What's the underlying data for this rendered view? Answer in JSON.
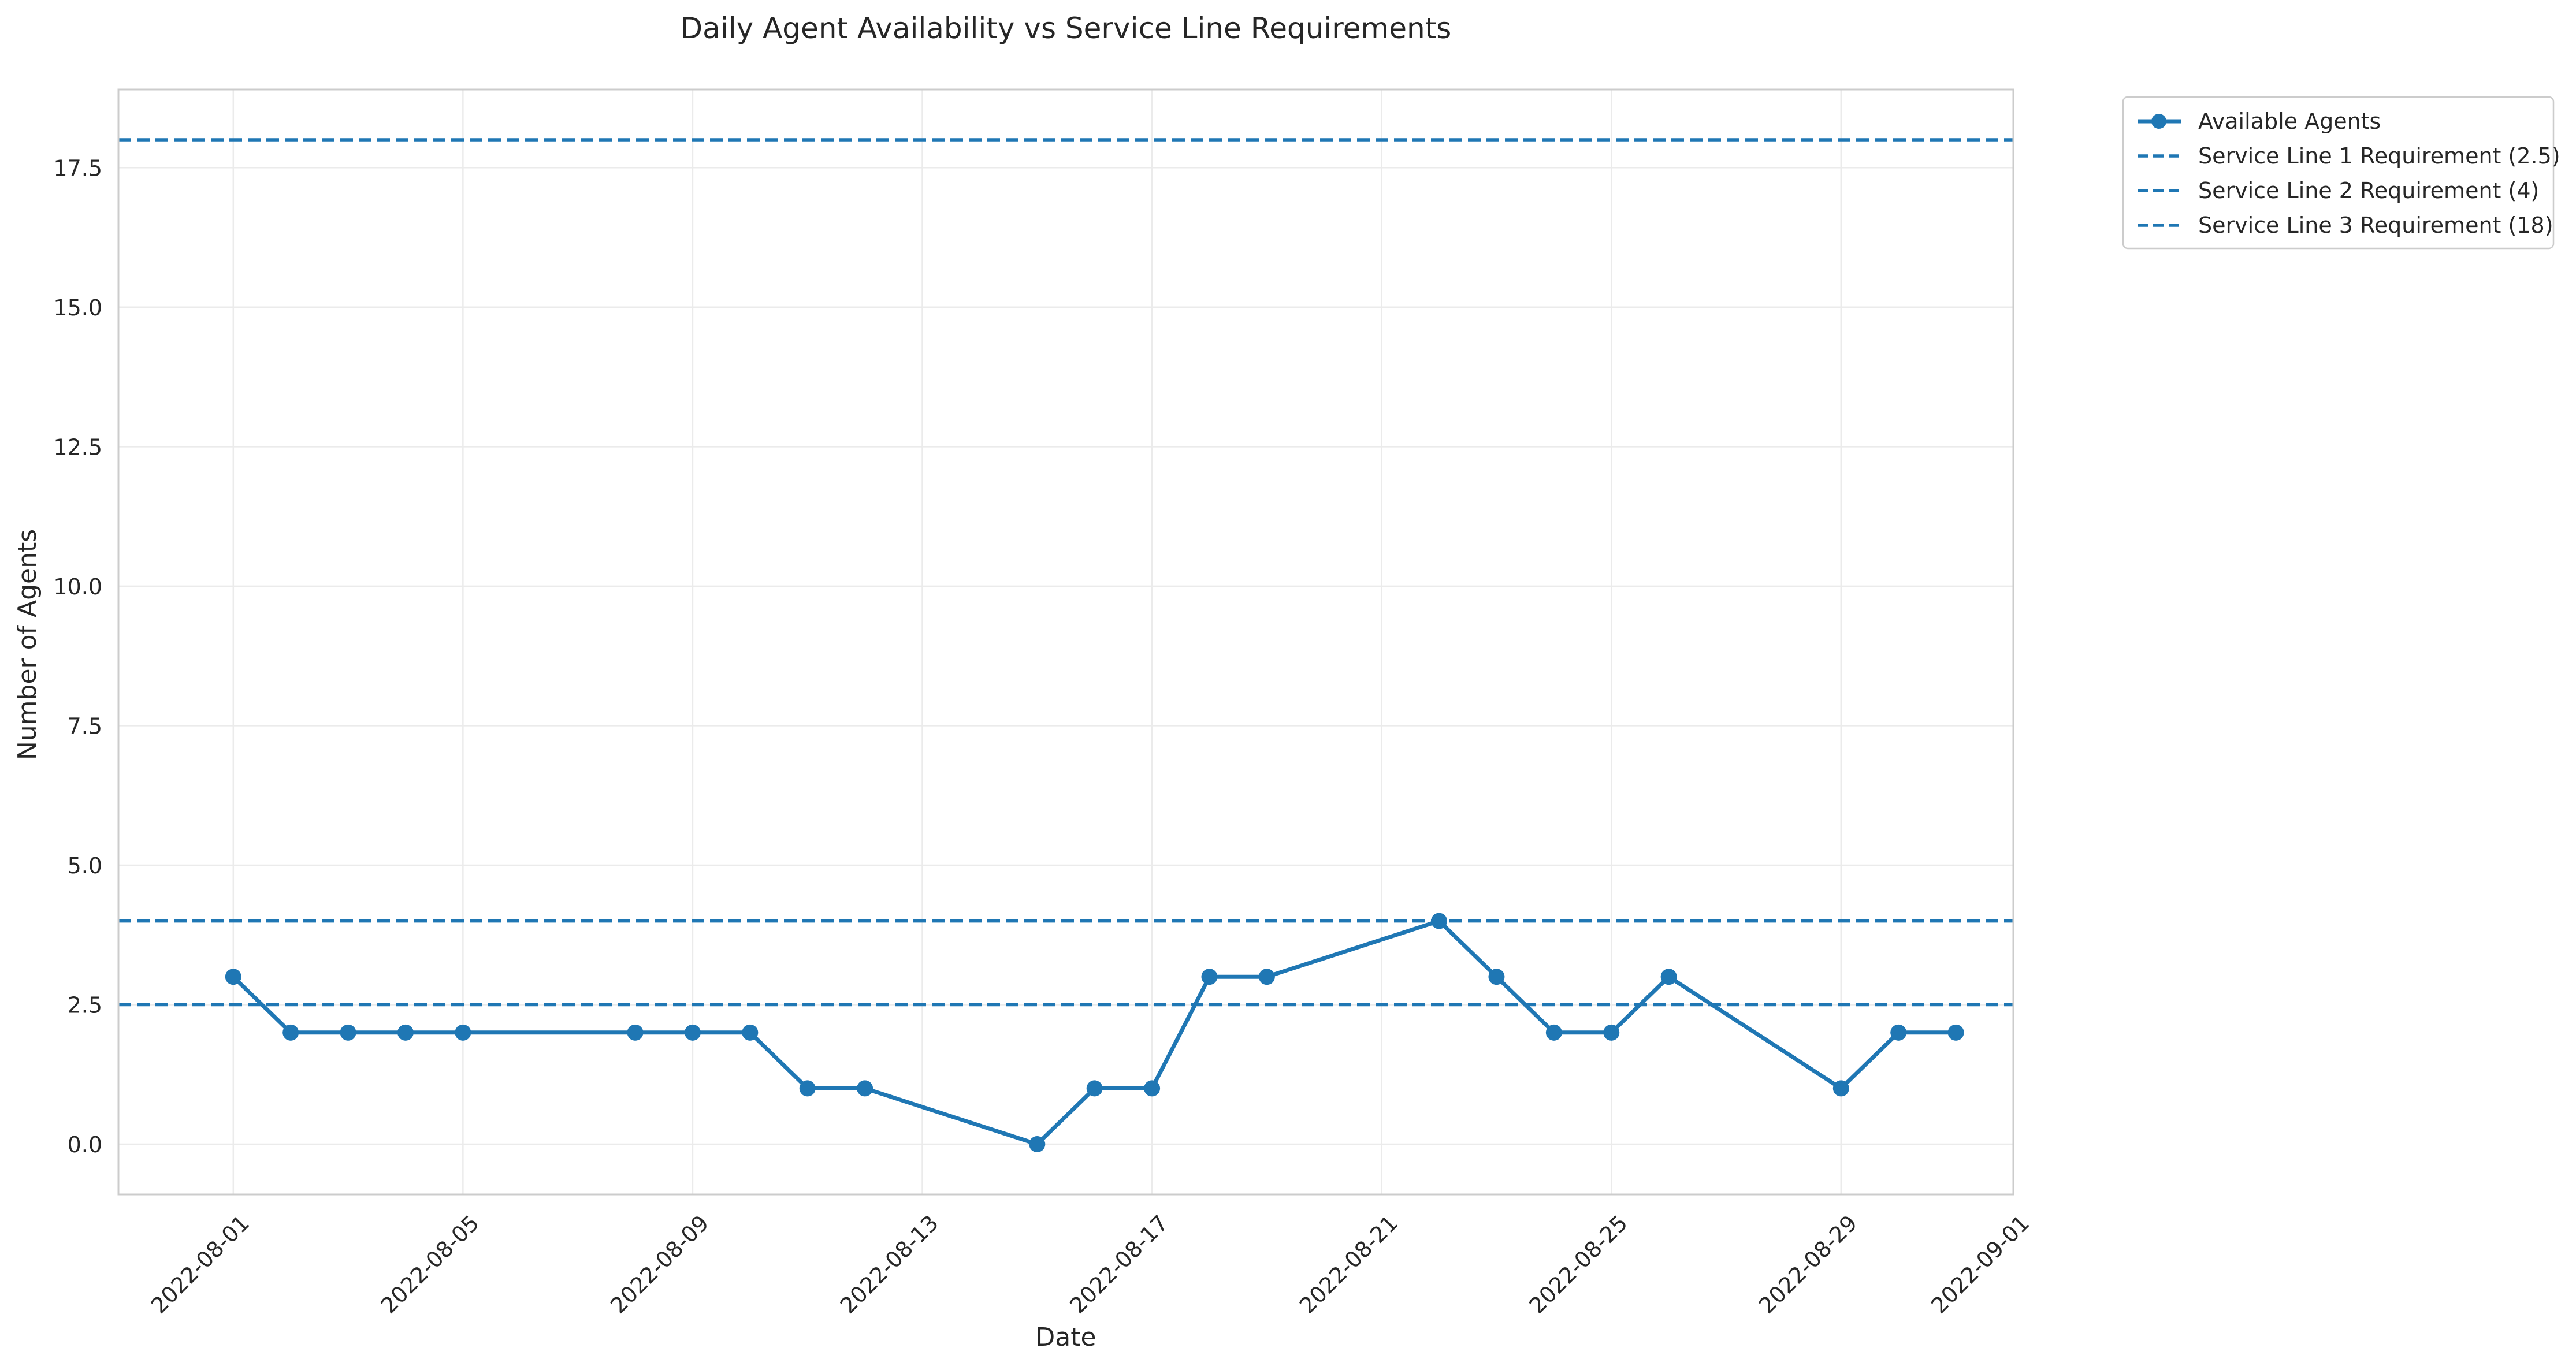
{
  "chart_data": {
    "type": "line",
    "title": "Daily Agent Availability vs Service Line Requirements",
    "xlabel": "Date",
    "ylabel": "Number of Agents",
    "xlim": [
      "2022-07-30",
      "2022-09-01"
    ],
    "ylim": [
      -0.9,
      18.9
    ],
    "x_ticks": [
      "2022-08-01",
      "2022-08-05",
      "2022-08-09",
      "2022-08-13",
      "2022-08-17",
      "2022-08-21",
      "2022-08-25",
      "2022-08-29",
      "2022-09-01"
    ],
    "y_ticks": [
      "0.0",
      "2.5",
      "5.0",
      "7.5",
      "10.0",
      "12.5",
      "15.0",
      "17.5"
    ],
    "y_tick_values": [
      0,
      2.5,
      5,
      7.5,
      10,
      12.5,
      15,
      17.5
    ],
    "grid": true,
    "legend_position": "outside-top-right",
    "series": [
      {
        "name": "Available Agents",
        "style": "solid-line-with-markers",
        "color": "#1f77b4",
        "points": [
          {
            "x": "2022-08-01",
            "y": 3
          },
          {
            "x": "2022-08-02",
            "y": 2
          },
          {
            "x": "2022-08-03",
            "y": 2
          },
          {
            "x": "2022-08-04",
            "y": 2
          },
          {
            "x": "2022-08-05",
            "y": 2
          },
          {
            "x": "2022-08-08",
            "y": 2
          },
          {
            "x": "2022-08-09",
            "y": 2
          },
          {
            "x": "2022-08-10",
            "y": 2
          },
          {
            "x": "2022-08-11",
            "y": 1
          },
          {
            "x": "2022-08-12",
            "y": 1
          },
          {
            "x": "2022-08-15",
            "y": 0
          },
          {
            "x": "2022-08-16",
            "y": 1
          },
          {
            "x": "2022-08-17",
            "y": 1
          },
          {
            "x": "2022-08-18",
            "y": 3
          },
          {
            "x": "2022-08-19",
            "y": 3
          },
          {
            "x": "2022-08-22",
            "y": 4
          },
          {
            "x": "2022-08-23",
            "y": 3
          },
          {
            "x": "2022-08-24",
            "y": 2
          },
          {
            "x": "2022-08-25",
            "y": 2
          },
          {
            "x": "2022-08-26",
            "y": 3
          },
          {
            "x": "2022-08-29",
            "y": 1
          },
          {
            "x": "2022-08-30",
            "y": 2
          },
          {
            "x": "2022-08-31",
            "y": 2
          }
        ]
      },
      {
        "name": "Service Line 1 Requirement (2.5)",
        "style": "dashed-horizontal",
        "color": "#1f77b4",
        "value": 2.5
      },
      {
        "name": "Service Line 2 Requirement (4)",
        "style": "dashed-horizontal",
        "color": "#1f77b4",
        "value": 4
      },
      {
        "name": "Service Line 3 Requirement (18)",
        "style": "dashed-horizontal",
        "color": "#1f77b4",
        "value": 18
      }
    ]
  }
}
